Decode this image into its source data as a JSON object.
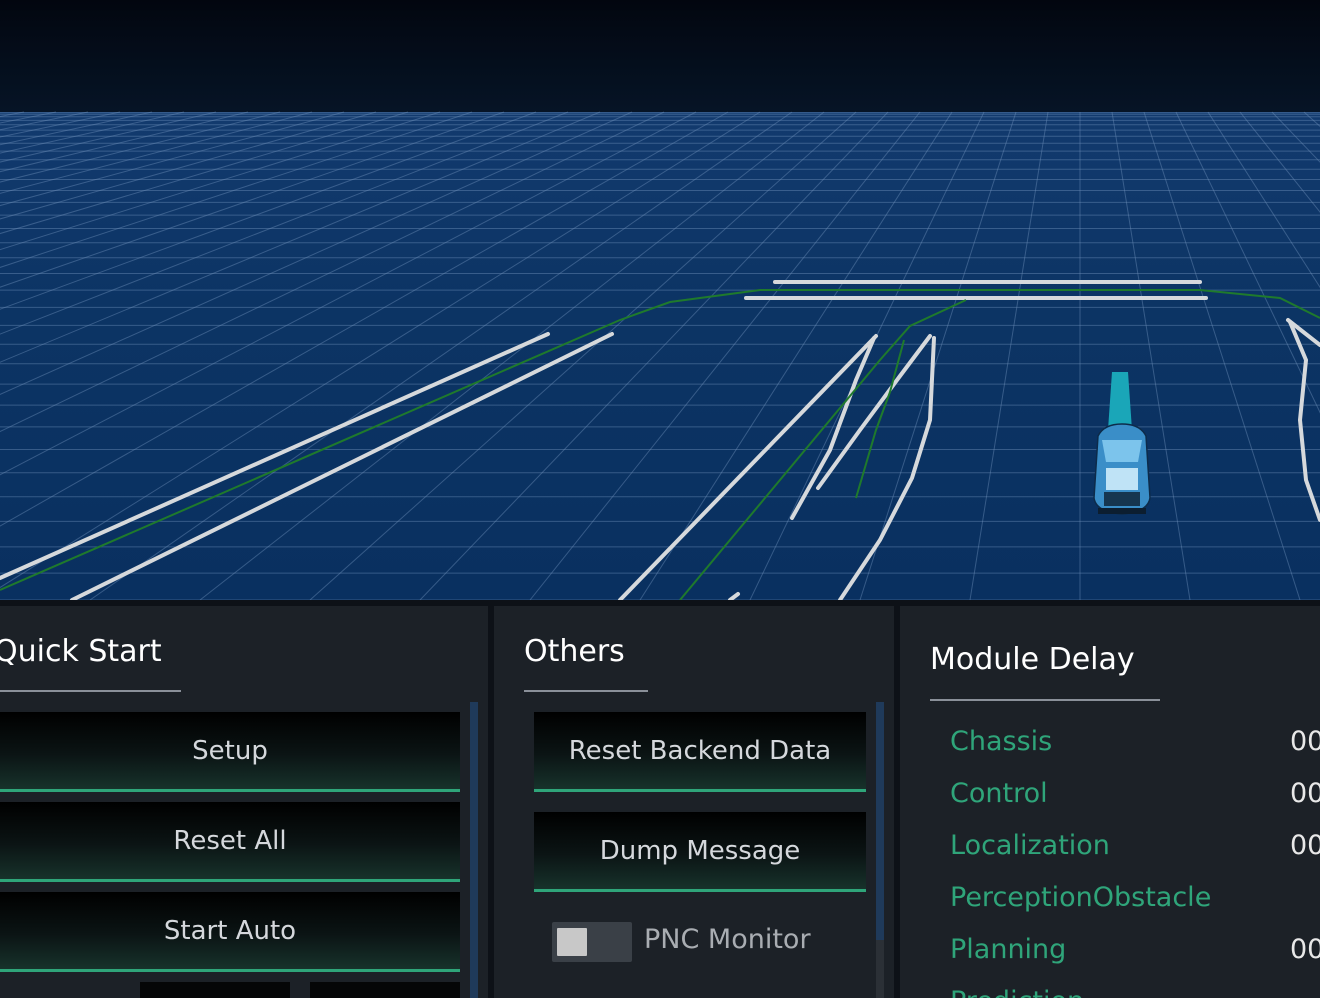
{
  "quick_start": {
    "title": "Quick Start",
    "buttons": [
      "Setup",
      "Reset All",
      "Start Auto"
    ]
  },
  "others": {
    "title": "Others",
    "buttons": [
      "Reset Backend Data",
      "Dump Message"
    ],
    "toggle": {
      "label": "PNC Monitor",
      "state": "off"
    }
  },
  "module_delay": {
    "title": "Module Delay",
    "rows": [
      {
        "name": "Chassis",
        "value": "00"
      },
      {
        "name": "Control",
        "value": "00"
      },
      {
        "name": "Localization",
        "value": "00"
      },
      {
        "name": "PerceptionObstacle",
        "value": ""
      },
      {
        "name": "Planning",
        "value": "00"
      },
      {
        "name": "Prediction",
        "value": ""
      }
    ]
  },
  "colors": {
    "accent_green": "#2fa57a",
    "ground_blue": "#0b3566",
    "sky_dark": "#040d1c"
  }
}
